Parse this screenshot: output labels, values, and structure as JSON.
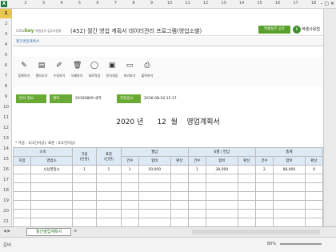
{
  "window": {
    "title_icon": "X",
    "controls": "– ▢ ✕"
  },
  "columns": [
    "2",
    "3",
    "4",
    "5",
    "6",
    "7",
    "8",
    "9",
    "10",
    "11",
    "12",
    "13",
    "14",
    "15",
    "16",
    "17",
    "18"
  ],
  "rows": [
    "1",
    "2",
    "3",
    "4",
    "5",
    "6",
    "7",
    "8",
    "9",
    "10",
    "11",
    "12",
    "13",
    "14",
    "15",
    "16",
    "17",
    "18",
    "19",
    "20",
    "21"
  ],
  "brand": {
    "logo_a": "cou",
    "logo_b": "key",
    "logo_sub": "엑셀실무 업무자동화",
    "title": "(452) 월간 영업 계획서 데이터관리 프로그램(영업소별)",
    "green_button": "엑셀실무 공유",
    "circle_label": "R",
    "right_text": "엑셀사용법"
  },
  "menu_tab": "월간영업계획서",
  "toolbar": [
    {
      "icon": "pencil-icon",
      "glyph": "✎",
      "label": "등록하기"
    },
    {
      "icon": "folder-open-icon",
      "glyph": "▤",
      "label": "열러오기"
    },
    {
      "icon": "edit-icon",
      "glyph": "✐",
      "label": "수정하기"
    },
    {
      "icon": "trash-icon",
      "glyph": "🗑",
      "label": "삭제하기"
    },
    {
      "icon": "new-doc-icon",
      "glyph": "◯",
      "label": "새로작성"
    },
    {
      "icon": "doc-save-icon",
      "glyph": "▣",
      "label": "문서저장"
    },
    {
      "icon": "preview-icon",
      "glyph": "▭",
      "label": "미리보기"
    },
    {
      "icon": "print-icon",
      "glyph": "⎙",
      "label": "출력하기"
    }
  ],
  "info": {
    "label_doc": "문서 정보",
    "label_title": "제목",
    "doc_value": "20160809 내역",
    "label_saved": "저장일시",
    "saved_value": "2016-08-24 15:17"
  },
  "doc": {
    "year": "2020",
    "year_unit": "년",
    "month": "12",
    "month_unit": "월",
    "name": "영업계획서"
  },
  "note": "* 가중 : 1(1인이상), 표준 : 5(1인이상)",
  "table": {
    "h_group1": "소속",
    "h_branch": "지점",
    "h_office": "영업소",
    "h_weight": "가중\n(인원)",
    "h_std": "표준\n(인원)",
    "h_monthly": "월납",
    "h_june": "6월 / 연납",
    "h_total": "총계",
    "sub": [
      "건수",
      "합비",
      "환산",
      "건수",
      "합비",
      "환산",
      "건수",
      "합비",
      "환산"
    ],
    "rows": [
      {
        "branch": "",
        "office": "사상영업소",
        "weight": "1",
        "std": "1",
        "m_cnt": "1",
        "m_amt": "50,000",
        "m_conv": "",
        "j_cnt": "1",
        "j_amt": "38,000",
        "j_conv": "",
        "t_cnt": "2",
        "t_amt": "88,000",
        "t_conv": "0"
      }
    ]
  },
  "sheet_tab": "월간영업계획서",
  "status": {
    "ready": "준비",
    "zoom": "80%"
  }
}
